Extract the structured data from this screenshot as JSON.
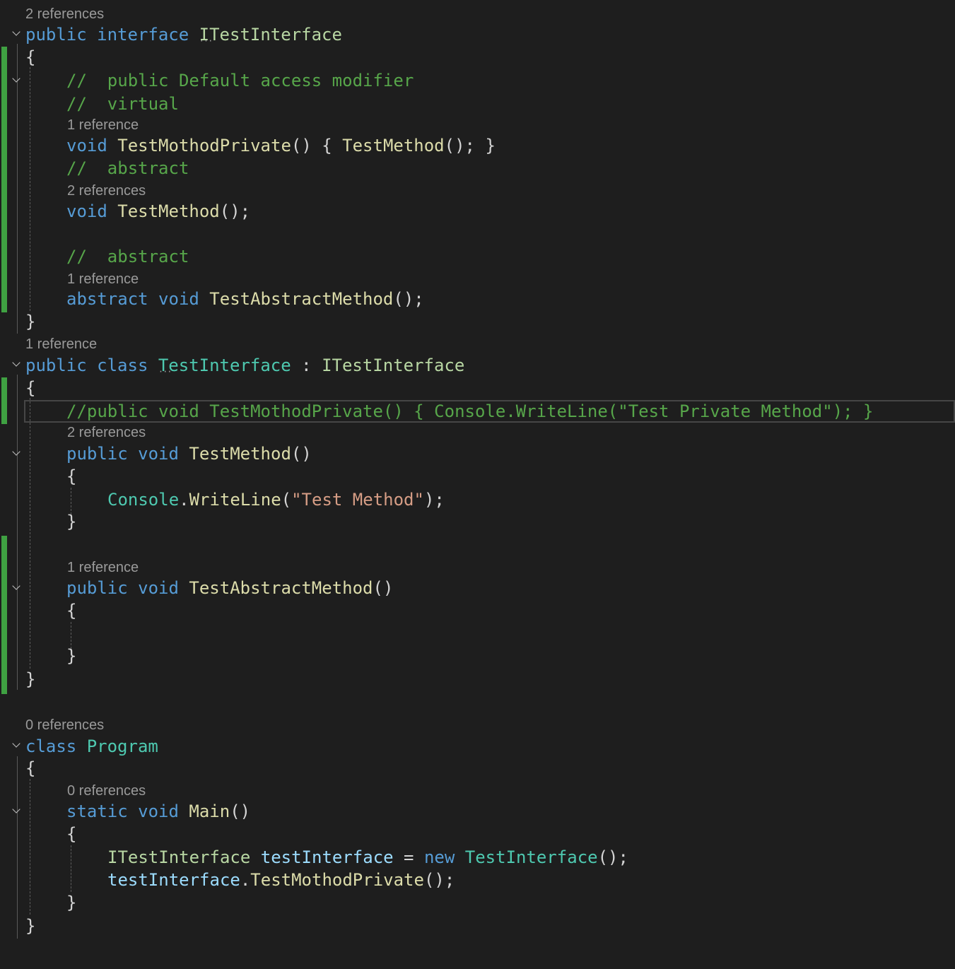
{
  "editor": {
    "language": "csharp",
    "colors": {
      "background": "#1e1e1e",
      "keyword": "#569cd6",
      "type": "#4ec9b0",
      "method": "#dcdcaa",
      "interface": "#b8d7a3",
      "variable": "#9cdcfe",
      "string": "#d69d85",
      "comment": "#57a64a",
      "codelens": "#9a9a9a",
      "change_bar": "#3fa142"
    },
    "lens": {
      "l1": "2 references",
      "l2": "1 reference",
      "l3": "2 references",
      "l4": "1 reference",
      "l5": "1 reference",
      "l6": "2 references",
      "l7": "1 reference",
      "l8": "0 references",
      "l9": "0 references"
    },
    "code": {
      "public": "public",
      "interface": "interface",
      "class": "class",
      "void": "void",
      "abstract": "abstract",
      "static": "static",
      "new": "new",
      "ITestInterface": "ITestInterface",
      "TestInterface": "TestInterface",
      "Program": "Program",
      "Console": "Console",
      "WriteLine": "WriteLine",
      "TestMothodPrivate": "TestMothodPrivate",
      "TestMethod": "TestMethod",
      "TestAbstractMethod": "TestAbstractMethod",
      "Main": "Main",
      "testInterface": "testInterface",
      "open_brace": "{",
      "close_brace": "}",
      "colon": " : ",
      "parens": "()",
      "parens_semi": "();",
      "dot": ".",
      "open_paren": "(",
      "close_paren_semi": ");",
      "equals": " = ",
      "tmp_body_open": "() { ",
      "tmp_body_close": "(); }",
      "str_test_method": "\"Test Method\"",
      "comment_default_access": "//  public Default access modifier",
      "comment_virtual": "//  virtual",
      "comment_abstract_1": "//  abstract",
      "comment_abstract_2": "//  abstract",
      "comment_private_impl": "//public void TestMothodPrivate() { Console.WriteLine(\"Test Private Method\"); }"
    }
  }
}
